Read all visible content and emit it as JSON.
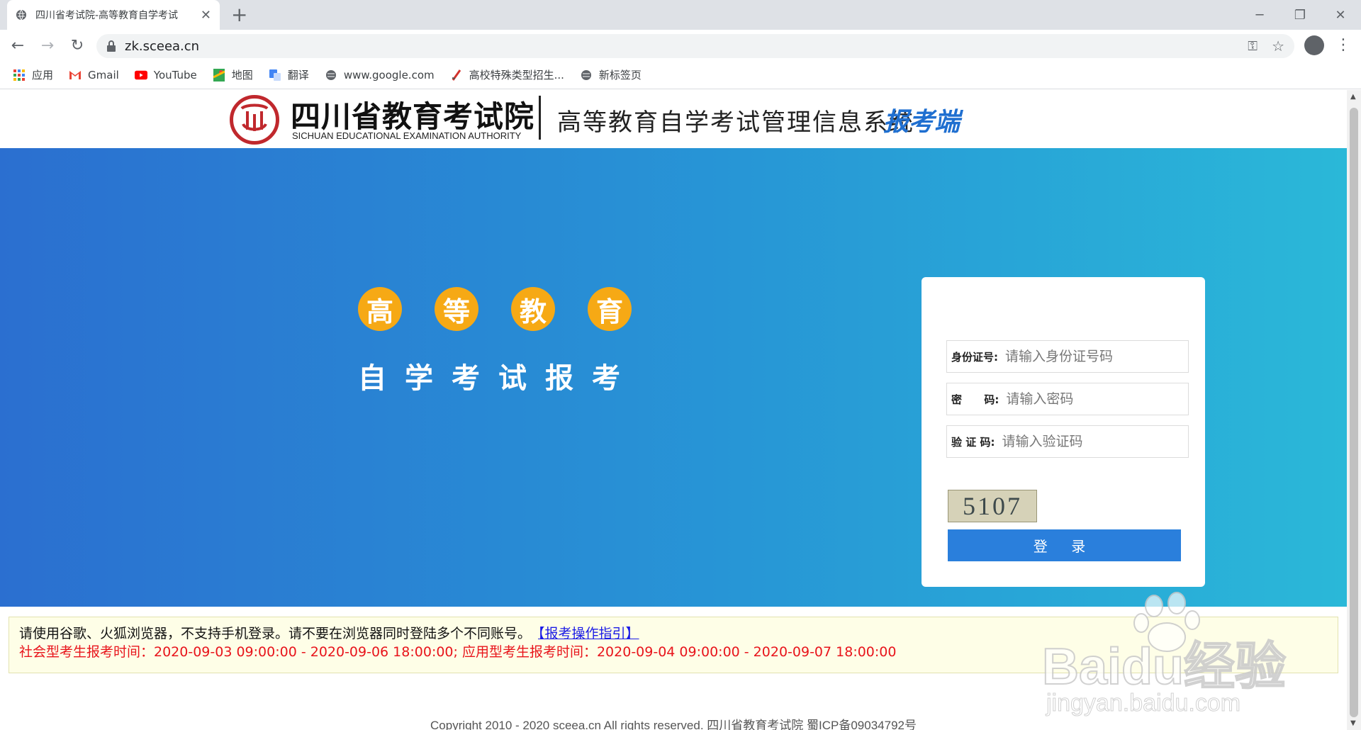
{
  "browser": {
    "tab_title": "四川省考试院-高等教育自学考试",
    "url": "zk.sceea.cn",
    "bookmarks": [
      "应用",
      "Gmail",
      "YouTube",
      "地图",
      "翻译",
      "www.google.com",
      "高校特殊类型招生...",
      "新标签页"
    ]
  },
  "header": {
    "org_name": "四川省教育考试院",
    "org_name_en": "SICHUAN EDUCATIONAL EXAMINATION AUTHORITY",
    "system_name": "高等教育自学考试管理信息系统",
    "system_suffix": "报考端"
  },
  "banner": {
    "circles": [
      "高",
      "等",
      "教",
      "育"
    ],
    "slogan": "自学考试报考"
  },
  "login": {
    "id_label": "身份证号:",
    "id_placeholder": "请输入身份证号码",
    "password_label": "密      码:",
    "password_placeholder": "请输入密码",
    "captcha_label": "验 证 码:",
    "captcha_placeholder": "请输入验证码",
    "captcha_text": "5107",
    "submit_label": "登 录"
  },
  "notice": {
    "line1": "请使用谷歌、火狐浏览器，不支持手机登录。请不要在浏览器同时登陆多个不同账号。",
    "guide_link": "【报考操作指引】",
    "line2": "社会型考生报考时间：2020-09-03 09:00:00 - 2020-09-06 18:00:00; 应用型考生报考时间：2020-09-04 09:00:00 - 2020-09-07 18:00:00"
  },
  "footer": {
    "copyright": "Copyright 2010 - 2020 sceea.cn All rights reserved. 四川省教育考试院 蜀ICP备09034792号"
  },
  "watermark": {
    "brand": "Baidu经验",
    "url": "jingyan.baidu.com"
  },
  "colors": {
    "accent_blue": "#2a7fdc",
    "circle_orange": "#f6a915",
    "notice_red": "#e8141b",
    "logo_red": "#c0282d"
  }
}
